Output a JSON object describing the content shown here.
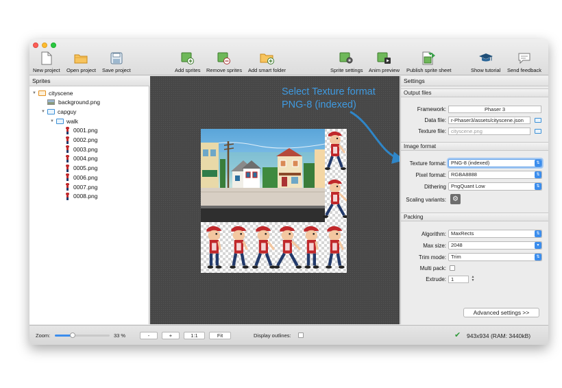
{
  "toolbar": {
    "new_project": "New project",
    "open_project": "Open project",
    "save_project": "Save project",
    "add_sprites": "Add sprites",
    "remove_sprites": "Remove sprites",
    "add_smart_folder": "Add smart folder",
    "sprite_settings": "Sprite settings",
    "anim_preview": "Anim preview",
    "publish_sprite_sheet": "Publish sprite sheet",
    "show_tutorial": "Show tutorial",
    "send_feedback": "Send feedback"
  },
  "sprites_panel": {
    "title": "Sprites",
    "tree": [
      {
        "label": "cityscene",
        "depth": 0,
        "kind": "folder-orange",
        "expanded": true
      },
      {
        "label": "background.png",
        "depth": 1,
        "kind": "image"
      },
      {
        "label": "capguy",
        "depth": 1,
        "kind": "folder",
        "expanded": true
      },
      {
        "label": "walk",
        "depth": 2,
        "kind": "folder",
        "expanded": true
      },
      {
        "label": "0001.png",
        "depth": 3,
        "kind": "sprite"
      },
      {
        "label": "0002.png",
        "depth": 3,
        "kind": "sprite"
      },
      {
        "label": "0003.png",
        "depth": 3,
        "kind": "sprite"
      },
      {
        "label": "0004.png",
        "depth": 3,
        "kind": "sprite"
      },
      {
        "label": "0005.png",
        "depth": 3,
        "kind": "sprite"
      },
      {
        "label": "0006.png",
        "depth": 3,
        "kind": "sprite"
      },
      {
        "label": "0007.png",
        "depth": 3,
        "kind": "sprite"
      },
      {
        "label": "0008.png",
        "depth": 3,
        "kind": "sprite"
      }
    ]
  },
  "annotation": {
    "line1": "Select Texture format",
    "line2": "PNG-8 (indexed)",
    "color": "#3f9ae0"
  },
  "settings": {
    "title": "Settings",
    "output_files": {
      "header": "Output files",
      "framework_label": "Framework:",
      "framework_value": "Phaser 3",
      "data_file_label": "Data file:",
      "data_file_value": "r-Phaser3/assets/cityscene.json",
      "texture_file_label": "Texture file:",
      "texture_file_placeholder": "cityscene.png"
    },
    "image_format": {
      "header": "Image format",
      "texture_format_label": "Texture format:",
      "texture_format_value": "PNG-8 (indexed)",
      "pixel_format_label": "Pixel format:",
      "pixel_format_value": "RGBA8888",
      "dithering_label": "Dithering",
      "dithering_value": "PngQuant Low",
      "scaling_variants_label": "Scaling variants:"
    },
    "packing": {
      "header": "Packing",
      "algorithm_label": "Algorithm:",
      "algorithm_value": "MaxRects",
      "max_size_label": "Max size:",
      "max_size_value": "2048",
      "trim_mode_label": "Trim mode:",
      "trim_mode_value": "Trim",
      "multi_pack_label": "Multi pack:",
      "extrude_label": "Extrude:",
      "extrude_value": "1"
    },
    "advanced_button": "Advanced settings >>"
  },
  "statusbar": {
    "zoom_label": "Zoom:",
    "zoom_value": "33 %",
    "zoom_fraction": 0.33,
    "zoom_out": "-",
    "zoom_in": "+",
    "zoom_actual": "1:1",
    "zoom_fit": "Fit",
    "display_outlines_label": "Display outlines:",
    "status_text": "943x934 (RAM: 3440kB)"
  },
  "colors": {
    "accent": "#3b8ded",
    "canvas": "#474747",
    "ok": "#2f9a3a"
  }
}
